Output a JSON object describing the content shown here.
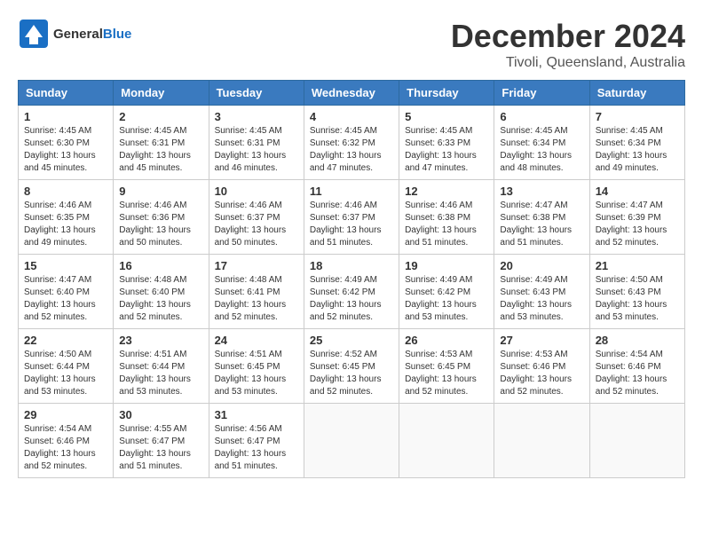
{
  "header": {
    "logo_general": "General",
    "logo_blue": "Blue",
    "month": "December 2024",
    "location": "Tivoli, Queensland, Australia"
  },
  "weekdays": [
    "Sunday",
    "Monday",
    "Tuesday",
    "Wednesday",
    "Thursday",
    "Friday",
    "Saturday"
  ],
  "weeks": [
    [
      {
        "day": "1",
        "sunrise": "Sunrise: 4:45 AM",
        "sunset": "Sunset: 6:30 PM",
        "daylight": "Daylight: 13 hours and 45 minutes."
      },
      {
        "day": "2",
        "sunrise": "Sunrise: 4:45 AM",
        "sunset": "Sunset: 6:31 PM",
        "daylight": "Daylight: 13 hours and 45 minutes."
      },
      {
        "day": "3",
        "sunrise": "Sunrise: 4:45 AM",
        "sunset": "Sunset: 6:31 PM",
        "daylight": "Daylight: 13 hours and 46 minutes."
      },
      {
        "day": "4",
        "sunrise": "Sunrise: 4:45 AM",
        "sunset": "Sunset: 6:32 PM",
        "daylight": "Daylight: 13 hours and 47 minutes."
      },
      {
        "day": "5",
        "sunrise": "Sunrise: 4:45 AM",
        "sunset": "Sunset: 6:33 PM",
        "daylight": "Daylight: 13 hours and 47 minutes."
      },
      {
        "day": "6",
        "sunrise": "Sunrise: 4:45 AM",
        "sunset": "Sunset: 6:34 PM",
        "daylight": "Daylight: 13 hours and 48 minutes."
      },
      {
        "day": "7",
        "sunrise": "Sunrise: 4:45 AM",
        "sunset": "Sunset: 6:34 PM",
        "daylight": "Daylight: 13 hours and 49 minutes."
      }
    ],
    [
      {
        "day": "8",
        "sunrise": "Sunrise: 4:46 AM",
        "sunset": "Sunset: 6:35 PM",
        "daylight": "Daylight: 13 hours and 49 minutes."
      },
      {
        "day": "9",
        "sunrise": "Sunrise: 4:46 AM",
        "sunset": "Sunset: 6:36 PM",
        "daylight": "Daylight: 13 hours and 50 minutes."
      },
      {
        "day": "10",
        "sunrise": "Sunrise: 4:46 AM",
        "sunset": "Sunset: 6:37 PM",
        "daylight": "Daylight: 13 hours and 50 minutes."
      },
      {
        "day": "11",
        "sunrise": "Sunrise: 4:46 AM",
        "sunset": "Sunset: 6:37 PM",
        "daylight": "Daylight: 13 hours and 51 minutes."
      },
      {
        "day": "12",
        "sunrise": "Sunrise: 4:46 AM",
        "sunset": "Sunset: 6:38 PM",
        "daylight": "Daylight: 13 hours and 51 minutes."
      },
      {
        "day": "13",
        "sunrise": "Sunrise: 4:47 AM",
        "sunset": "Sunset: 6:38 PM",
        "daylight": "Daylight: 13 hours and 51 minutes."
      },
      {
        "day": "14",
        "sunrise": "Sunrise: 4:47 AM",
        "sunset": "Sunset: 6:39 PM",
        "daylight": "Daylight: 13 hours and 52 minutes."
      }
    ],
    [
      {
        "day": "15",
        "sunrise": "Sunrise: 4:47 AM",
        "sunset": "Sunset: 6:40 PM",
        "daylight": "Daylight: 13 hours and 52 minutes."
      },
      {
        "day": "16",
        "sunrise": "Sunrise: 4:48 AM",
        "sunset": "Sunset: 6:40 PM",
        "daylight": "Daylight: 13 hours and 52 minutes."
      },
      {
        "day": "17",
        "sunrise": "Sunrise: 4:48 AM",
        "sunset": "Sunset: 6:41 PM",
        "daylight": "Daylight: 13 hours and 52 minutes."
      },
      {
        "day": "18",
        "sunrise": "Sunrise: 4:49 AM",
        "sunset": "Sunset: 6:42 PM",
        "daylight": "Daylight: 13 hours and 52 minutes."
      },
      {
        "day": "19",
        "sunrise": "Sunrise: 4:49 AM",
        "sunset": "Sunset: 6:42 PM",
        "daylight": "Daylight: 13 hours and 53 minutes."
      },
      {
        "day": "20",
        "sunrise": "Sunrise: 4:49 AM",
        "sunset": "Sunset: 6:43 PM",
        "daylight": "Daylight: 13 hours and 53 minutes."
      },
      {
        "day": "21",
        "sunrise": "Sunrise: 4:50 AM",
        "sunset": "Sunset: 6:43 PM",
        "daylight": "Daylight: 13 hours and 53 minutes."
      }
    ],
    [
      {
        "day": "22",
        "sunrise": "Sunrise: 4:50 AM",
        "sunset": "Sunset: 6:44 PM",
        "daylight": "Daylight: 13 hours and 53 minutes."
      },
      {
        "day": "23",
        "sunrise": "Sunrise: 4:51 AM",
        "sunset": "Sunset: 6:44 PM",
        "daylight": "Daylight: 13 hours and 53 minutes."
      },
      {
        "day": "24",
        "sunrise": "Sunrise: 4:51 AM",
        "sunset": "Sunset: 6:45 PM",
        "daylight": "Daylight: 13 hours and 53 minutes."
      },
      {
        "day": "25",
        "sunrise": "Sunrise: 4:52 AM",
        "sunset": "Sunset: 6:45 PM",
        "daylight": "Daylight: 13 hours and 52 minutes."
      },
      {
        "day": "26",
        "sunrise": "Sunrise: 4:53 AM",
        "sunset": "Sunset: 6:45 PM",
        "daylight": "Daylight: 13 hours and 52 minutes."
      },
      {
        "day": "27",
        "sunrise": "Sunrise: 4:53 AM",
        "sunset": "Sunset: 6:46 PM",
        "daylight": "Daylight: 13 hours and 52 minutes."
      },
      {
        "day": "28",
        "sunrise": "Sunrise: 4:54 AM",
        "sunset": "Sunset: 6:46 PM",
        "daylight": "Daylight: 13 hours and 52 minutes."
      }
    ],
    [
      {
        "day": "29",
        "sunrise": "Sunrise: 4:54 AM",
        "sunset": "Sunset: 6:46 PM",
        "daylight": "Daylight: 13 hours and 52 minutes."
      },
      {
        "day": "30",
        "sunrise": "Sunrise: 4:55 AM",
        "sunset": "Sunset: 6:47 PM",
        "daylight": "Daylight: 13 hours and 51 minutes."
      },
      {
        "day": "31",
        "sunrise": "Sunrise: 4:56 AM",
        "sunset": "Sunset: 6:47 PM",
        "daylight": "Daylight: 13 hours and 51 minutes."
      },
      null,
      null,
      null,
      null
    ]
  ]
}
